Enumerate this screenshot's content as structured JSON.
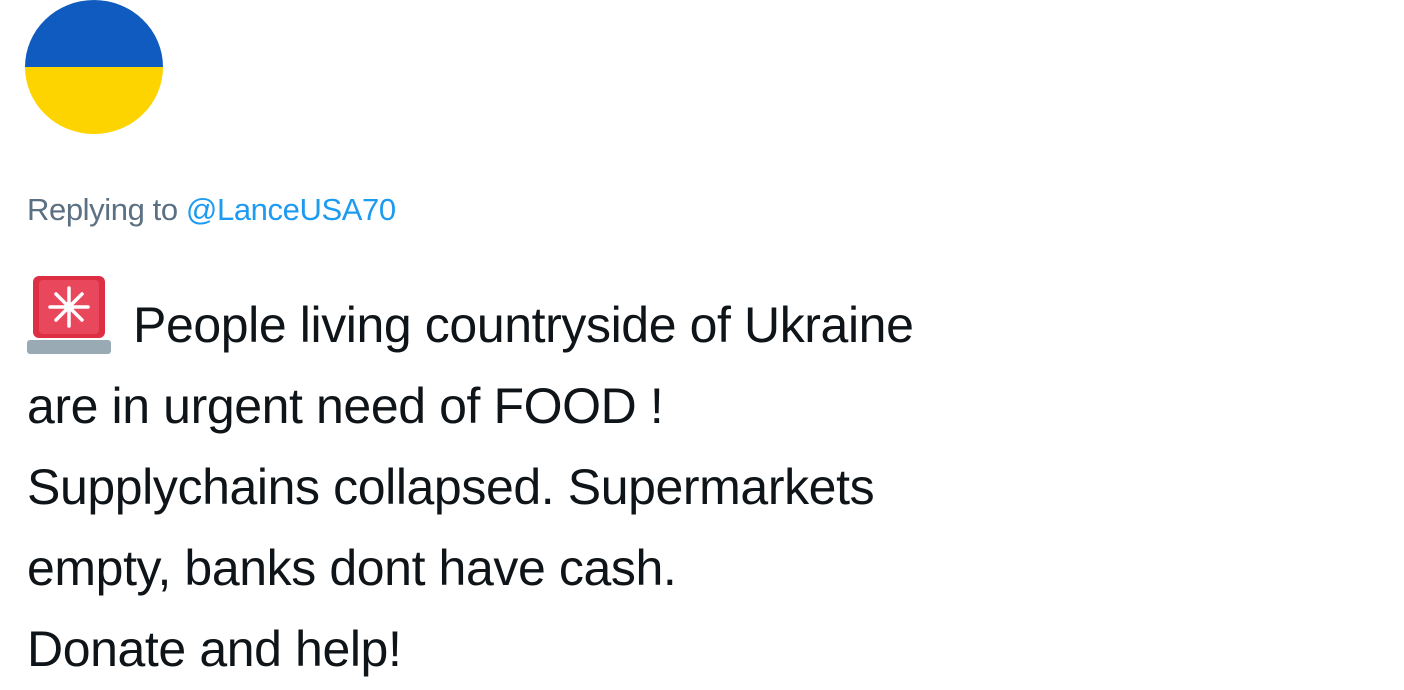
{
  "avatar": {
    "colors": {
      "top": "#0f5bbf",
      "bottom": "#fdd400"
    }
  },
  "reply": {
    "prefix": "Replying to",
    "mention": "@LanceUSA70",
    "mention_color": "#1d9bf0"
  },
  "tweet": {
    "icon": "police-car-light-icon",
    "lines": [
      "People living countryside of Ukraine",
      "are in urgent need of FOOD !",
      "Supplychains collapsed. Supermarkets",
      "empty, banks dont have cash.",
      "Donate and help!"
    ]
  }
}
